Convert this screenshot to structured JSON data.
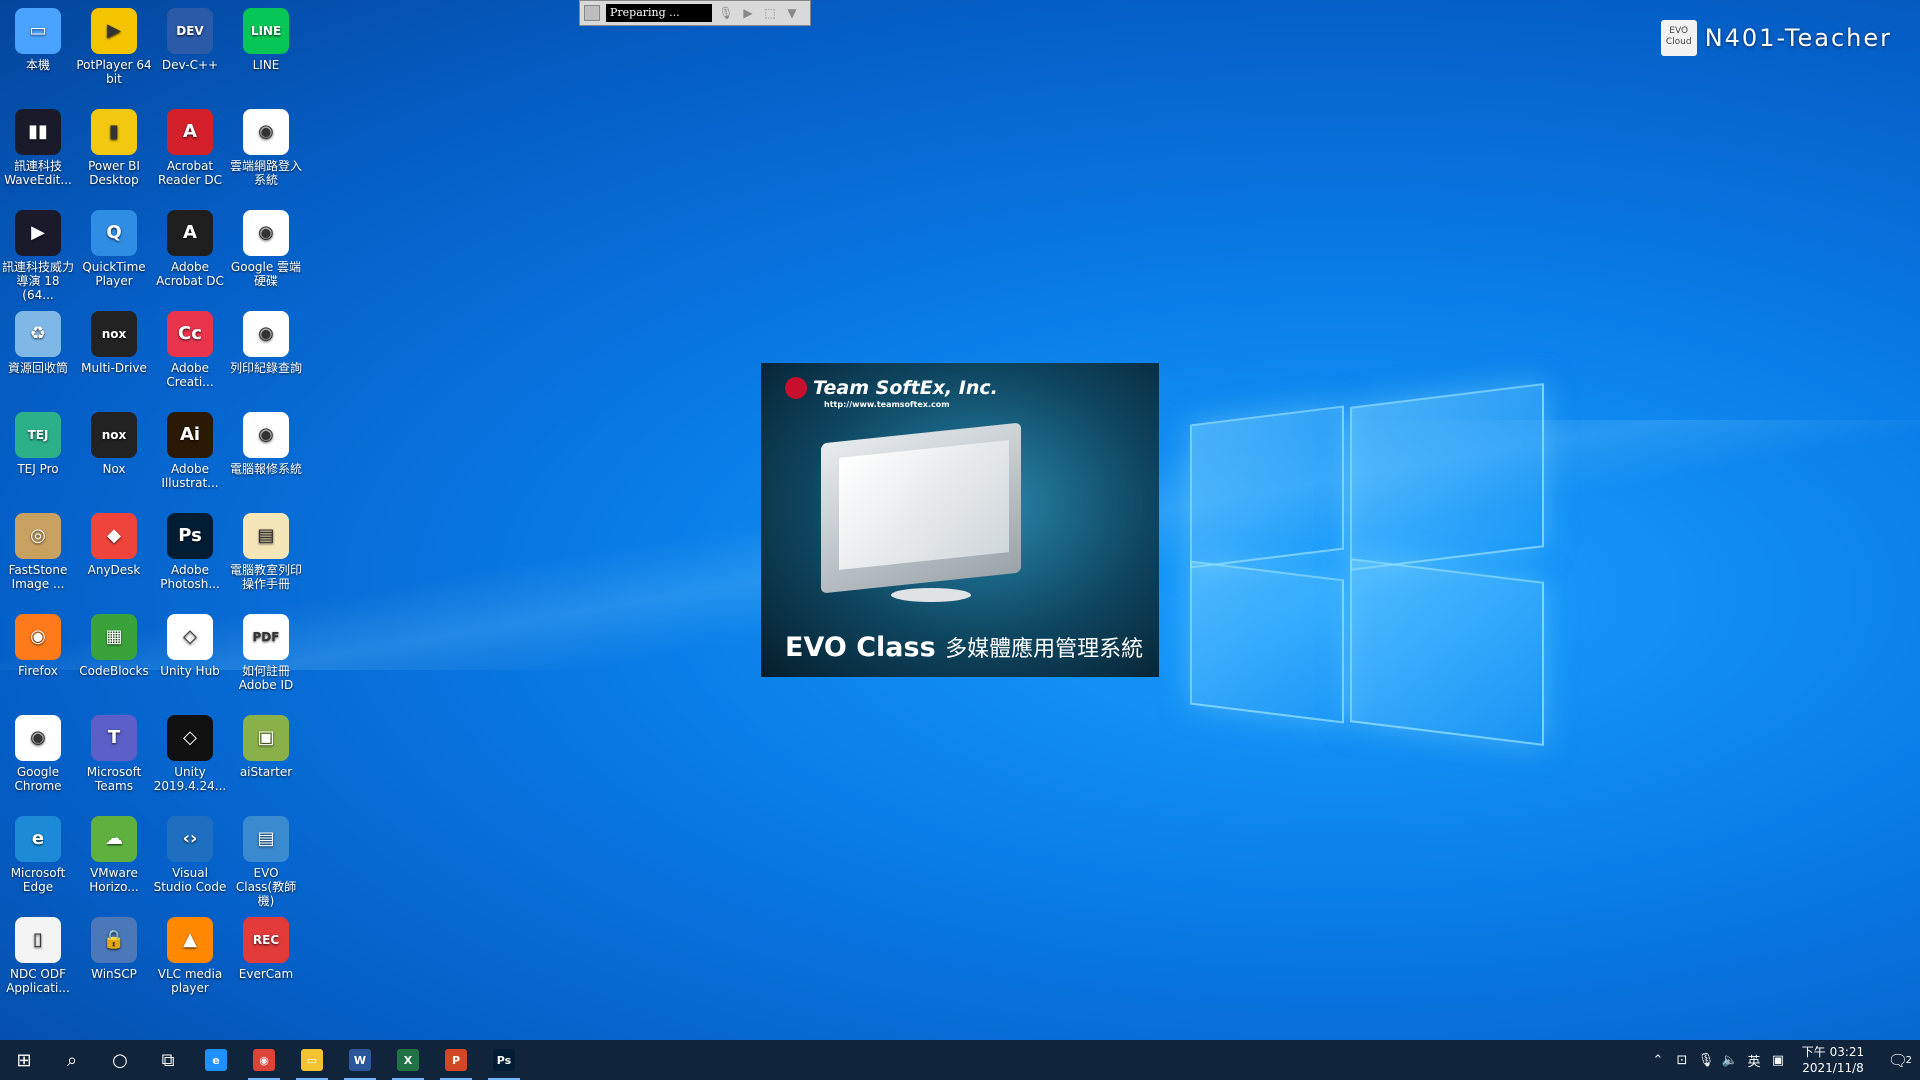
{
  "recorder": {
    "status": "Preparing ..."
  },
  "machine": {
    "logo_text": "EVO Cloud",
    "name": "N401-Teacher"
  },
  "splash": {
    "company": "Team SoftEx, Inc.",
    "url": "http://www.teamsoftex.com",
    "title_en": "EVO Class",
    "title_zh": "多媒體應用管理系統"
  },
  "desktop_icons": [
    {
      "label": "本機",
      "color": "#4aa3ff",
      "glyph": "▭"
    },
    {
      "label": "PotPlayer 64 bit",
      "color": "#f5c400",
      "glyph": "▶"
    },
    {
      "label": "Dev-C++",
      "color": "#2a5aa8",
      "glyph": "DEV"
    },
    {
      "label": "LINE",
      "color": "#06c755",
      "glyph": "LINE"
    },
    {
      "label": "訊連科技 WaveEdit...",
      "color": "#1a1a2a",
      "glyph": "▮▮"
    },
    {
      "label": "Power BI Desktop",
      "color": "#f2c811",
      "glyph": "▮"
    },
    {
      "label": "Acrobat Reader DC",
      "color": "#d4202a",
      "glyph": "A"
    },
    {
      "label": "雲端網路登入系統",
      "color": "#ffffff",
      "glyph": "◉"
    },
    {
      "label": "訊連科技威力導演 18 (64...",
      "color": "#1a1a2a",
      "glyph": "▶"
    },
    {
      "label": "QuickTime Player",
      "color": "#2f8de4",
      "glyph": "Q"
    },
    {
      "label": "Adobe Acrobat DC",
      "color": "#1e1e1e",
      "glyph": "A"
    },
    {
      "label": "Google 雲端硬碟",
      "color": "#ffffff",
      "glyph": "◉"
    },
    {
      "label": "資源回收筒",
      "color": "#7fb8e6",
      "glyph": "♻"
    },
    {
      "label": "Multi-Drive",
      "color": "#222222",
      "glyph": "nox"
    },
    {
      "label": "Adobe Creati...",
      "color": "#e8344c",
      "glyph": "Cc"
    },
    {
      "label": "列印紀錄查詢",
      "color": "#ffffff",
      "glyph": "◉"
    },
    {
      "label": "TEJ Pro",
      "color": "#2bb08a",
      "glyph": "TEJ"
    },
    {
      "label": "Nox",
      "color": "#222222",
      "glyph": "nox"
    },
    {
      "label": "Adobe Illustrat...",
      "color": "#2a1a05",
      "glyph": "Ai"
    },
    {
      "label": "電腦報修系統",
      "color": "#ffffff",
      "glyph": "◉"
    },
    {
      "label": "FastStone Image ...",
      "color": "#c8a060",
      "glyph": "◎"
    },
    {
      "label": "AnyDesk",
      "color": "#ef443b",
      "glyph": "◆"
    },
    {
      "label": "Adobe Photosh...",
      "color": "#001d34",
      "glyph": "Ps"
    },
    {
      "label": "電腦教室列印操作手冊",
      "color": "#f5e6b8",
      "glyph": "▤"
    },
    {
      "label": "Firefox",
      "color": "#ff7a1a",
      "glyph": "◉"
    },
    {
      "label": "CodeBlocks",
      "color": "#3aa23a",
      "glyph": "▦"
    },
    {
      "label": "Unity Hub",
      "color": "#ffffff",
      "glyph": "◇"
    },
    {
      "label": "如何註冊 Adobe ID",
      "color": "#ffffff",
      "glyph": "PDF"
    },
    {
      "label": "Google Chrome",
      "color": "#ffffff",
      "glyph": "◉"
    },
    {
      "label": "Microsoft Teams",
      "color": "#5b5fc7",
      "glyph": "T"
    },
    {
      "label": "Unity 2019.4.24...",
      "color": "#111111",
      "glyph": "◇"
    },
    {
      "label": "aiStarter",
      "color": "#8ab04a",
      "glyph": "▣"
    },
    {
      "label": "Microsoft Edge",
      "color": "#1d8ad8",
      "glyph": "e"
    },
    {
      "label": "VMware Horizo...",
      "color": "#60b040",
      "glyph": "☁"
    },
    {
      "label": "Visual Studio Code",
      "color": "#1e6fbf",
      "glyph": "‹›"
    },
    {
      "label": "EVO Class(教師機)",
      "color": "#3a8ad0",
      "glyph": "▤"
    },
    {
      "label": "NDC ODF Applicati...",
      "color": "#f4f4f4",
      "glyph": "▯"
    },
    {
      "label": "WinSCP",
      "color": "#4a78b8",
      "glyph": "🔒"
    },
    {
      "label": "VLC media player",
      "color": "#ff8800",
      "glyph": "▲"
    },
    {
      "label": "EverCam",
      "color": "#e33a3a",
      "glyph": "REC"
    }
  ],
  "taskbar": {
    "apps": [
      {
        "name": "start",
        "glyph": "⊞"
      },
      {
        "name": "search",
        "glyph": "⌕"
      },
      {
        "name": "cortana",
        "glyph": "○"
      },
      {
        "name": "task-view",
        "glyph": "⧉"
      },
      {
        "name": "ie",
        "glyph": "e",
        "color": "#1e90ff"
      },
      {
        "name": "chrome",
        "glyph": "◉",
        "color": "#db4437"
      },
      {
        "name": "explorer",
        "glyph": "▭",
        "color": "#f2c230"
      },
      {
        "name": "word",
        "glyph": "W",
        "color": "#2b579a"
      },
      {
        "name": "excel",
        "glyph": "X",
        "color": "#217346"
      },
      {
        "name": "powerpoint",
        "glyph": "P",
        "color": "#d24726"
      },
      {
        "name": "photoshop",
        "glyph": "Ps",
        "color": "#001d34"
      }
    ],
    "tray": {
      "ime": "英",
      "time": "下午 03:21",
      "date": "2021/11/8",
      "notifications": "2"
    }
  }
}
